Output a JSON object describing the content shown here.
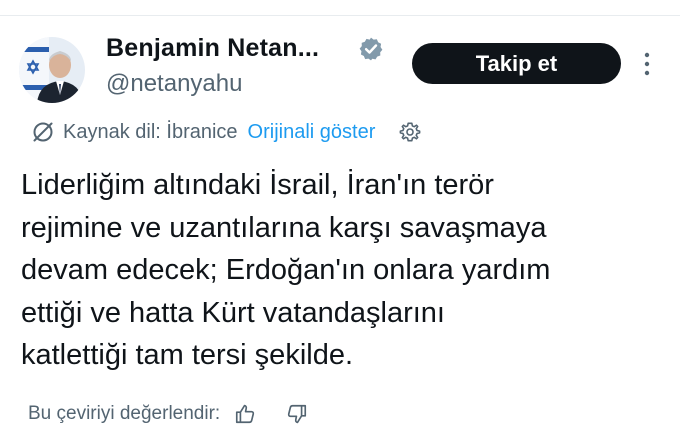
{
  "header": {
    "display_name": "Benjamin Netan...",
    "handle": "@netanyahu",
    "follow_label": "Takip et",
    "verified_color": "#829aab"
  },
  "translation": {
    "source_language": "Kaynak dil: İbranice",
    "show_original_label": "Orijinali göster",
    "link_color": "#1d9bf0"
  },
  "tweet": {
    "lines": [
      "Liderliğim altındaki İsrail, İran'ın terör",
      "rejimine ve uzantılarına karşı savaşmaya",
      "devam edecek; Erdoğan'ın onlara yardım",
      "ettiği ve hatta Kürt vatandaşlarını",
      "katlettiği tam tersi şekilde."
    ]
  },
  "rating": {
    "prompt": "Bu çeviriyi değerlendir:"
  },
  "icons": [
    "verified-badge-icon",
    "more-options-icon",
    "no-translate-icon",
    "settings-icon",
    "thumbs-up-icon",
    "thumbs-down-icon"
  ]
}
